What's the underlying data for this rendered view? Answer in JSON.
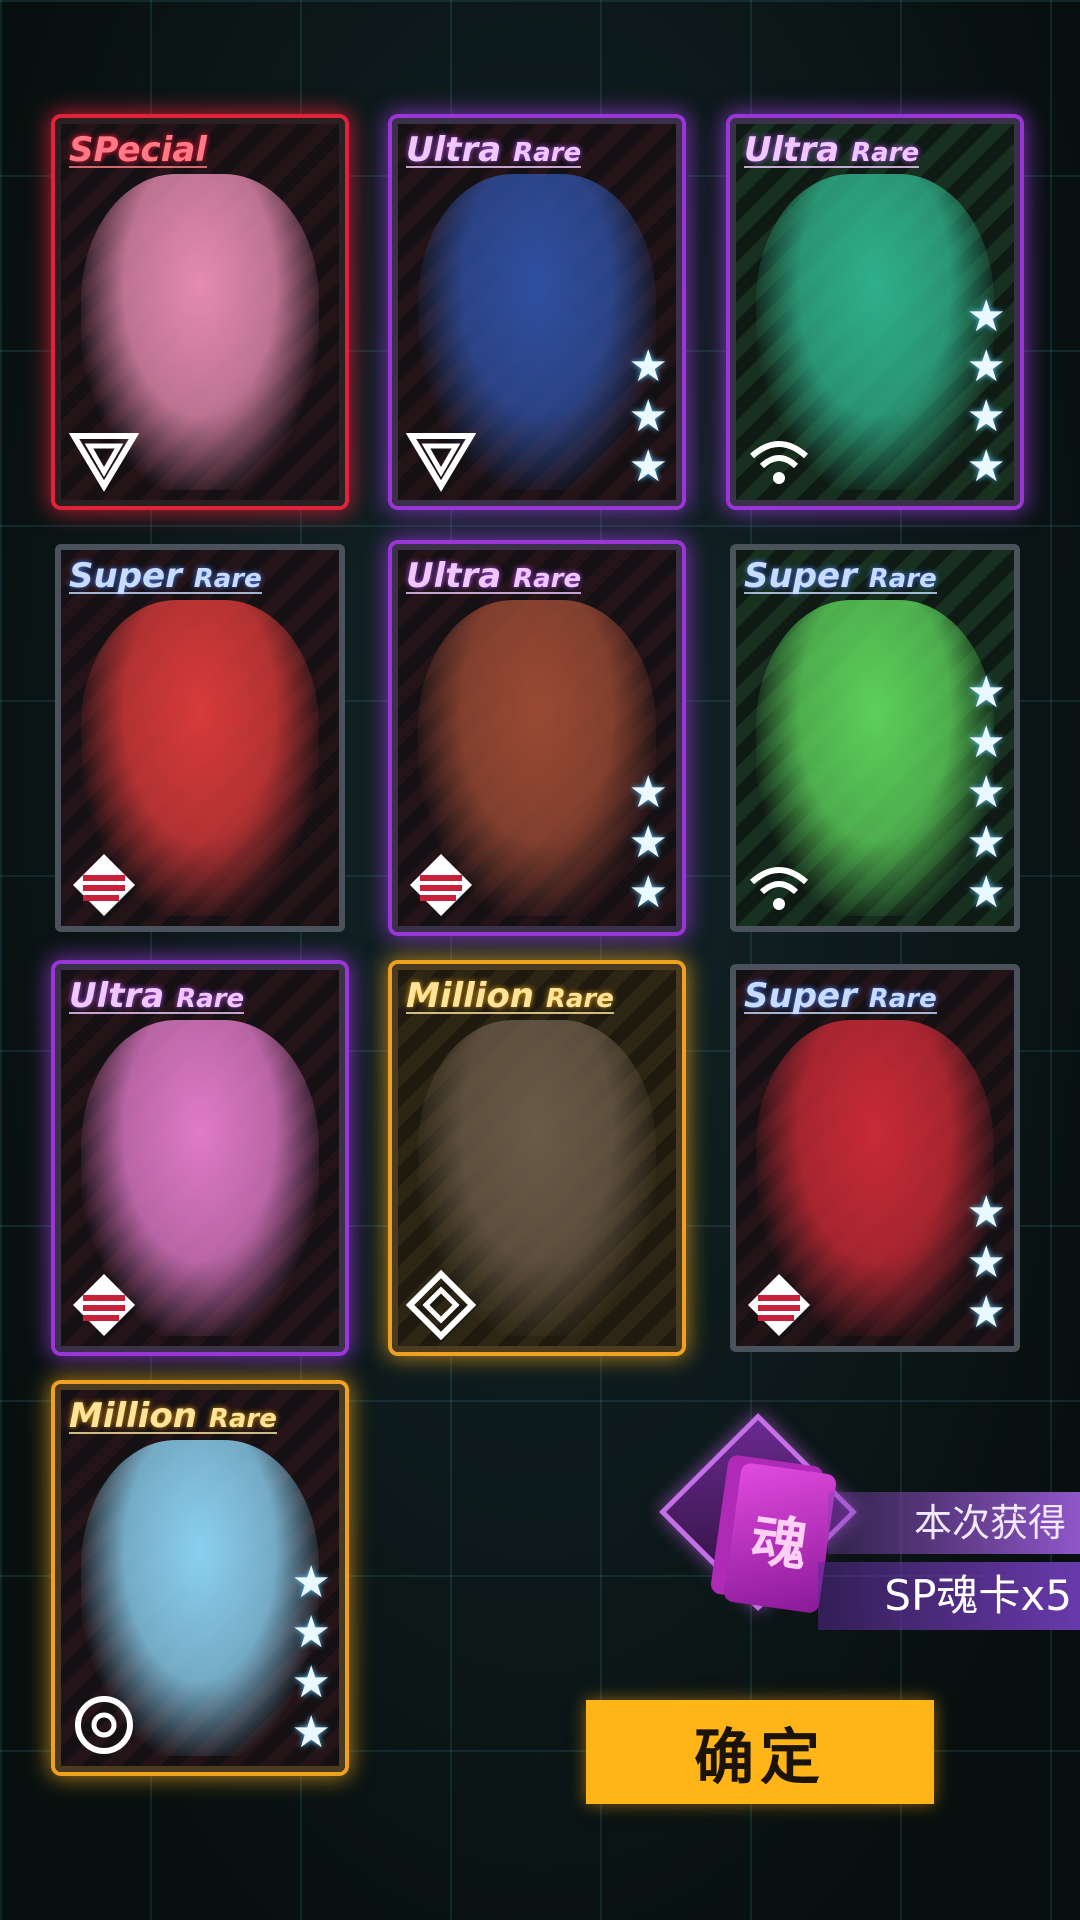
{
  "cards": [
    {
      "rarity_main": "SPecial",
      "rarity_sub": "",
      "tier": "sp",
      "stars": 0,
      "emblem": "triangle-emblem-icon",
      "art": "#e58bb0"
    },
    {
      "rarity_main": "Ultra",
      "rarity_sub": "Rare",
      "tier": "ur",
      "stars": 3,
      "emblem": "triangle-emblem-icon",
      "art": "#2f4fa0"
    },
    {
      "rarity_main": "Ultra",
      "rarity_sub": "Rare",
      "tier": "ur",
      "stars": 4,
      "emblem": "wifi-emblem-icon",
      "art": "#2fb08a"
    },
    {
      "rarity_main": "Super",
      "rarity_sub": "Rare",
      "tier": "sr",
      "stars": 0,
      "emblem": "stripes-emblem-icon",
      "art": "#d83a3a"
    },
    {
      "rarity_main": "Ultra",
      "rarity_sub": "Rare",
      "tier": "ur",
      "stars": 3,
      "emblem": "stripes-emblem-icon",
      "art": "#9a4a34"
    },
    {
      "rarity_main": "Super",
      "rarity_sub": "Rare",
      "tier": "sr",
      "stars": 5,
      "emblem": "wifi-emblem-icon",
      "art": "#5ccf5a"
    },
    {
      "rarity_main": "Ultra",
      "rarity_sub": "Rare",
      "tier": "ur",
      "stars": 0,
      "emblem": "stripes-emblem-icon",
      "art": "#e07ac8"
    },
    {
      "rarity_main": "Million",
      "rarity_sub": "Rare",
      "tier": "mr",
      "stars": 0,
      "emblem": "diamond-emblem-icon",
      "art": "#6a5a48"
    },
    {
      "rarity_main": "Super",
      "rarity_sub": "Rare",
      "tier": "sr",
      "stars": 3,
      "emblem": "stripes-emblem-icon",
      "art": "#c82a36"
    },
    {
      "rarity_main": "Million",
      "rarity_sub": "Rare",
      "tier": "mr",
      "stars": 4,
      "emblem": "ring-emblem-icon",
      "art": "#8ad0f0"
    }
  ],
  "reward": {
    "soul_glyph": "魂",
    "line1": "本次获得",
    "line2": "SP魂卡x5"
  },
  "confirm_label": "确定"
}
